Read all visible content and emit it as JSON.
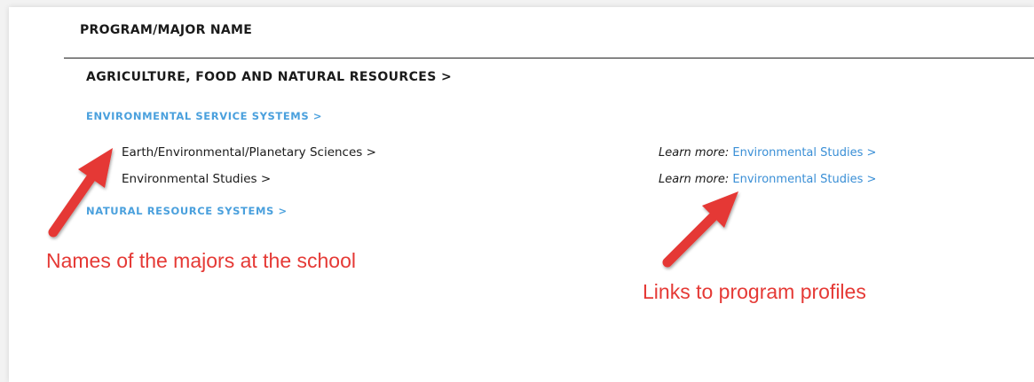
{
  "table": {
    "header": "PROGRAM/MAJOR NAME",
    "category": "AGRICULTURE, FOOD AND NATURAL RESOURCES >",
    "clusters": [
      {
        "label": "ENVIRONMENTAL SERVICE SYSTEMS >",
        "majors": [
          {
            "name": "Earth/Environmental/Planetary Sciences >",
            "learn_more_label": "Learn more:",
            "link": "Environmental Studies >"
          },
          {
            "name": "Environmental Studies >",
            "learn_more_label": "Learn more:",
            "link": "Environmental Studies >"
          }
        ]
      },
      {
        "label": "NATURAL RESOURCE SYSTEMS >",
        "majors": []
      }
    ]
  },
  "annotations": {
    "majors_note": "Names of the majors at the school",
    "links_note": "Links to program profiles",
    "color": "#e53935"
  },
  "colors": {
    "link_blue": "#3a8fd6",
    "cluster_blue": "#4aa0dd",
    "text": "#1a1a1a"
  }
}
